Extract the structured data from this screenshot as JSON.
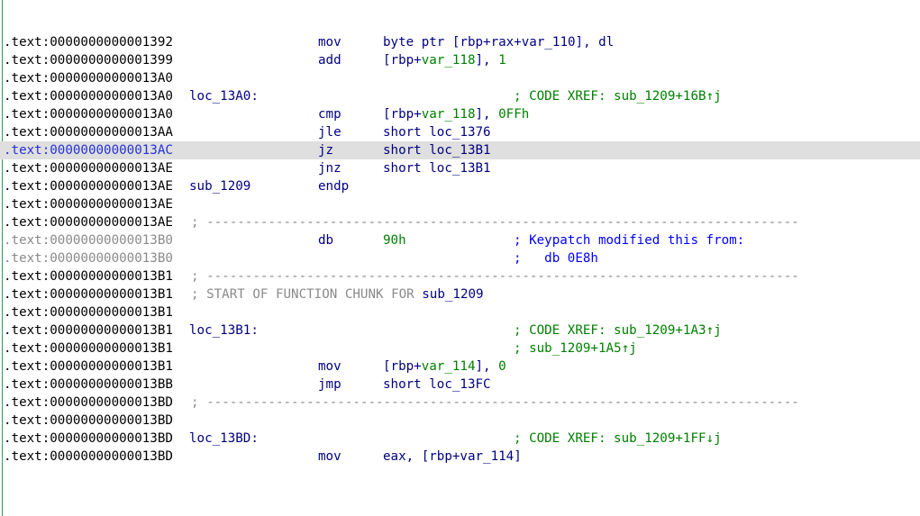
{
  "listing": {
    "lines": [
      {
        "addr": ".text:0000000000001392",
        "mn": "mov",
        "op": "byte ptr [rbp+rax+var_110], dl"
      },
      {
        "addr": ".text:0000000000001399",
        "mn": "add",
        "op_a": "[rbp+",
        "op_var": "var_118",
        "op_b": "], ",
        "op_num": "1"
      },
      {
        "addr": ".text:00000000000013A0"
      },
      {
        "addr": ".text:00000000000013A0",
        "label": "loc_13A0:",
        "xref_prefix": "; CODE XREF: ",
        "xref_target": "sub_1209+16B↑j"
      },
      {
        "addr": ".text:00000000000013A0",
        "mn": "cmp",
        "op_a": "[rbp+",
        "op_var": "var_118",
        "op_b": "], ",
        "op_num": "0FFh"
      },
      {
        "addr": ".text:00000000000013AA",
        "mn": "jle",
        "op": "short loc_1376"
      },
      {
        "addr": ".text:00000000000013AC",
        "mn": "jz",
        "op": "short loc_13B1"
      },
      {
        "addr": ".text:00000000000013AE",
        "mn": "jnz",
        "op": "short loc_13B1"
      },
      {
        "addr": ".text:00000000000013AE",
        "label": "sub_1209",
        "mn": "endp"
      },
      {
        "addr": ".text:00000000000013AE"
      },
      {
        "addr": ".text:00000000000013AE",
        "sep": "; -----------------------------------------------------------------------------"
      },
      {
        "addr": ".text:00000000000013B0",
        "mn": "db",
        "op_num": "90h",
        "comment": "; Keypatch modified this from:"
      },
      {
        "addr": ".text:00000000000013B0",
        "comment": ";   db 0E8h"
      },
      {
        "addr": ".text:00000000000013B1",
        "sep": "; -----------------------------------------------------------------------------"
      },
      {
        "addr": ".text:00000000000013B1",
        "chunk_prefix": "; START OF FUNCTION CHUNK FOR ",
        "chunk_fn": "sub_1209"
      },
      {
        "addr": ".text:00000000000013B1"
      },
      {
        "addr": ".text:00000000000013B1",
        "label": "loc_13B1:",
        "xref_prefix": "; CODE XREF: ",
        "xref_target": "sub_1209+1A3↑j"
      },
      {
        "addr": ".text:00000000000013B1",
        "xref_prefix": "; ",
        "xref_target": "sub_1209+1A5↑j"
      },
      {
        "addr": ".text:00000000000013B1",
        "mn": "mov",
        "op_a": "[rbp+",
        "op_var": "var_114",
        "op_b": "], ",
        "op_num": "0"
      },
      {
        "addr": ".text:00000000000013BB",
        "mn": "jmp",
        "op": "short loc_13FC"
      },
      {
        "addr": ".text:00000000000013BD",
        "sep": "; -----------------------------------------------------------------------------"
      },
      {
        "addr": ".text:00000000000013BD"
      },
      {
        "addr": ".text:00000000000013BD",
        "label": "loc_13BD:",
        "xref_prefix": "; CODE XREF: ",
        "xref_target": "sub_1209+1FF↓j"
      },
      {
        "addr": ".text:00000000000013BD",
        "mn": "mov",
        "op": "eax, [rbp+var_114]"
      }
    ],
    "highlight_index": 6,
    "dim_indices": [
      11,
      12
    ]
  }
}
